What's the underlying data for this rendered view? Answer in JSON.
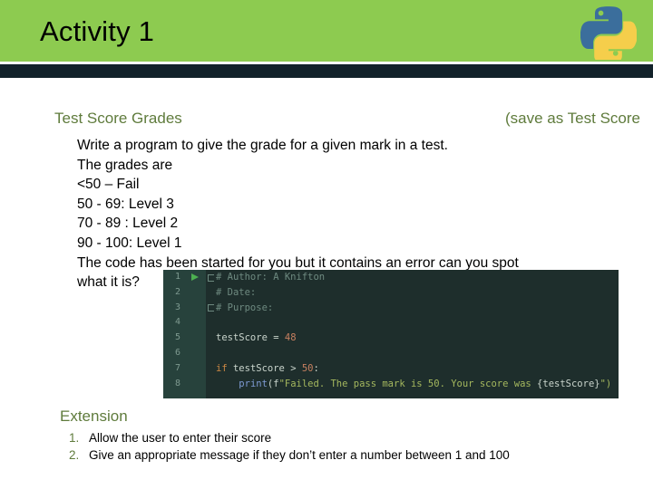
{
  "header": {
    "title": "Activity 1",
    "band_color": "#8DCB50",
    "stripe_color": "#12222A",
    "logo_name": "python-logo",
    "logo_text": "python"
  },
  "main": {
    "section_heading": "Test Score Grades",
    "save_as_note": "(save as Test Score",
    "heading_color": "#5F7B3C",
    "lines": [
      "Write a program to give the grade for a given mark in a test.",
      "The grades are",
      "<50 – Fail",
      "50 - 69:  Level 3",
      "70 - 89 : Level 2",
      "90 - 100: Level 1",
      "The code has been started for you but it contains an error can you spot",
      "what it is?"
    ]
  },
  "code_screenshot": {
    "theme_background": "#1E2E2C",
    "gutter_background": "#27423C",
    "run_arrow_color": "#4CAF50",
    "line_numbers": [
      "1",
      "2",
      "3",
      "4",
      "5",
      "6",
      "7",
      "8"
    ],
    "lines": [
      {
        "n": "1",
        "text": "# Author: A Knifton"
      },
      {
        "n": "2",
        "text": "# Date:"
      },
      {
        "n": "3",
        "text": "# Purpose:"
      },
      {
        "n": "4",
        "text": ""
      },
      {
        "n": "5",
        "text": "testScore = 48"
      },
      {
        "n": "6",
        "text": ""
      },
      {
        "n": "7",
        "text": "if testScore > 50:"
      },
      {
        "n": "8",
        "text": "    print(f\"Failed. The pass mark is 50. Your score was {testScore}\")"
      }
    ],
    "tokens": {
      "comment_author": "# Author: A Knifton",
      "comment_date": "# Date:",
      "comment_purpose": "# Purpose:",
      "var_name": "testScore",
      "assign_op": " = ",
      "assign_value": "48",
      "keyword_if": "if",
      "if_condition": " testScore > ",
      "if_number": "50",
      "if_colon": ":",
      "print_fn": "print",
      "print_open": "(f",
      "print_string": "\"Failed. The pass mark is 50. Your score was ",
      "print_interp": "{testScore}",
      "print_close": "\")"
    }
  },
  "extension": {
    "heading": "Extension",
    "items": [
      {
        "num": "1.",
        "text": "Allow the user to enter their score"
      },
      {
        "num": "2.",
        "text": "Give an appropriate message if they don’t enter a number between 1 and 100"
      }
    ]
  }
}
